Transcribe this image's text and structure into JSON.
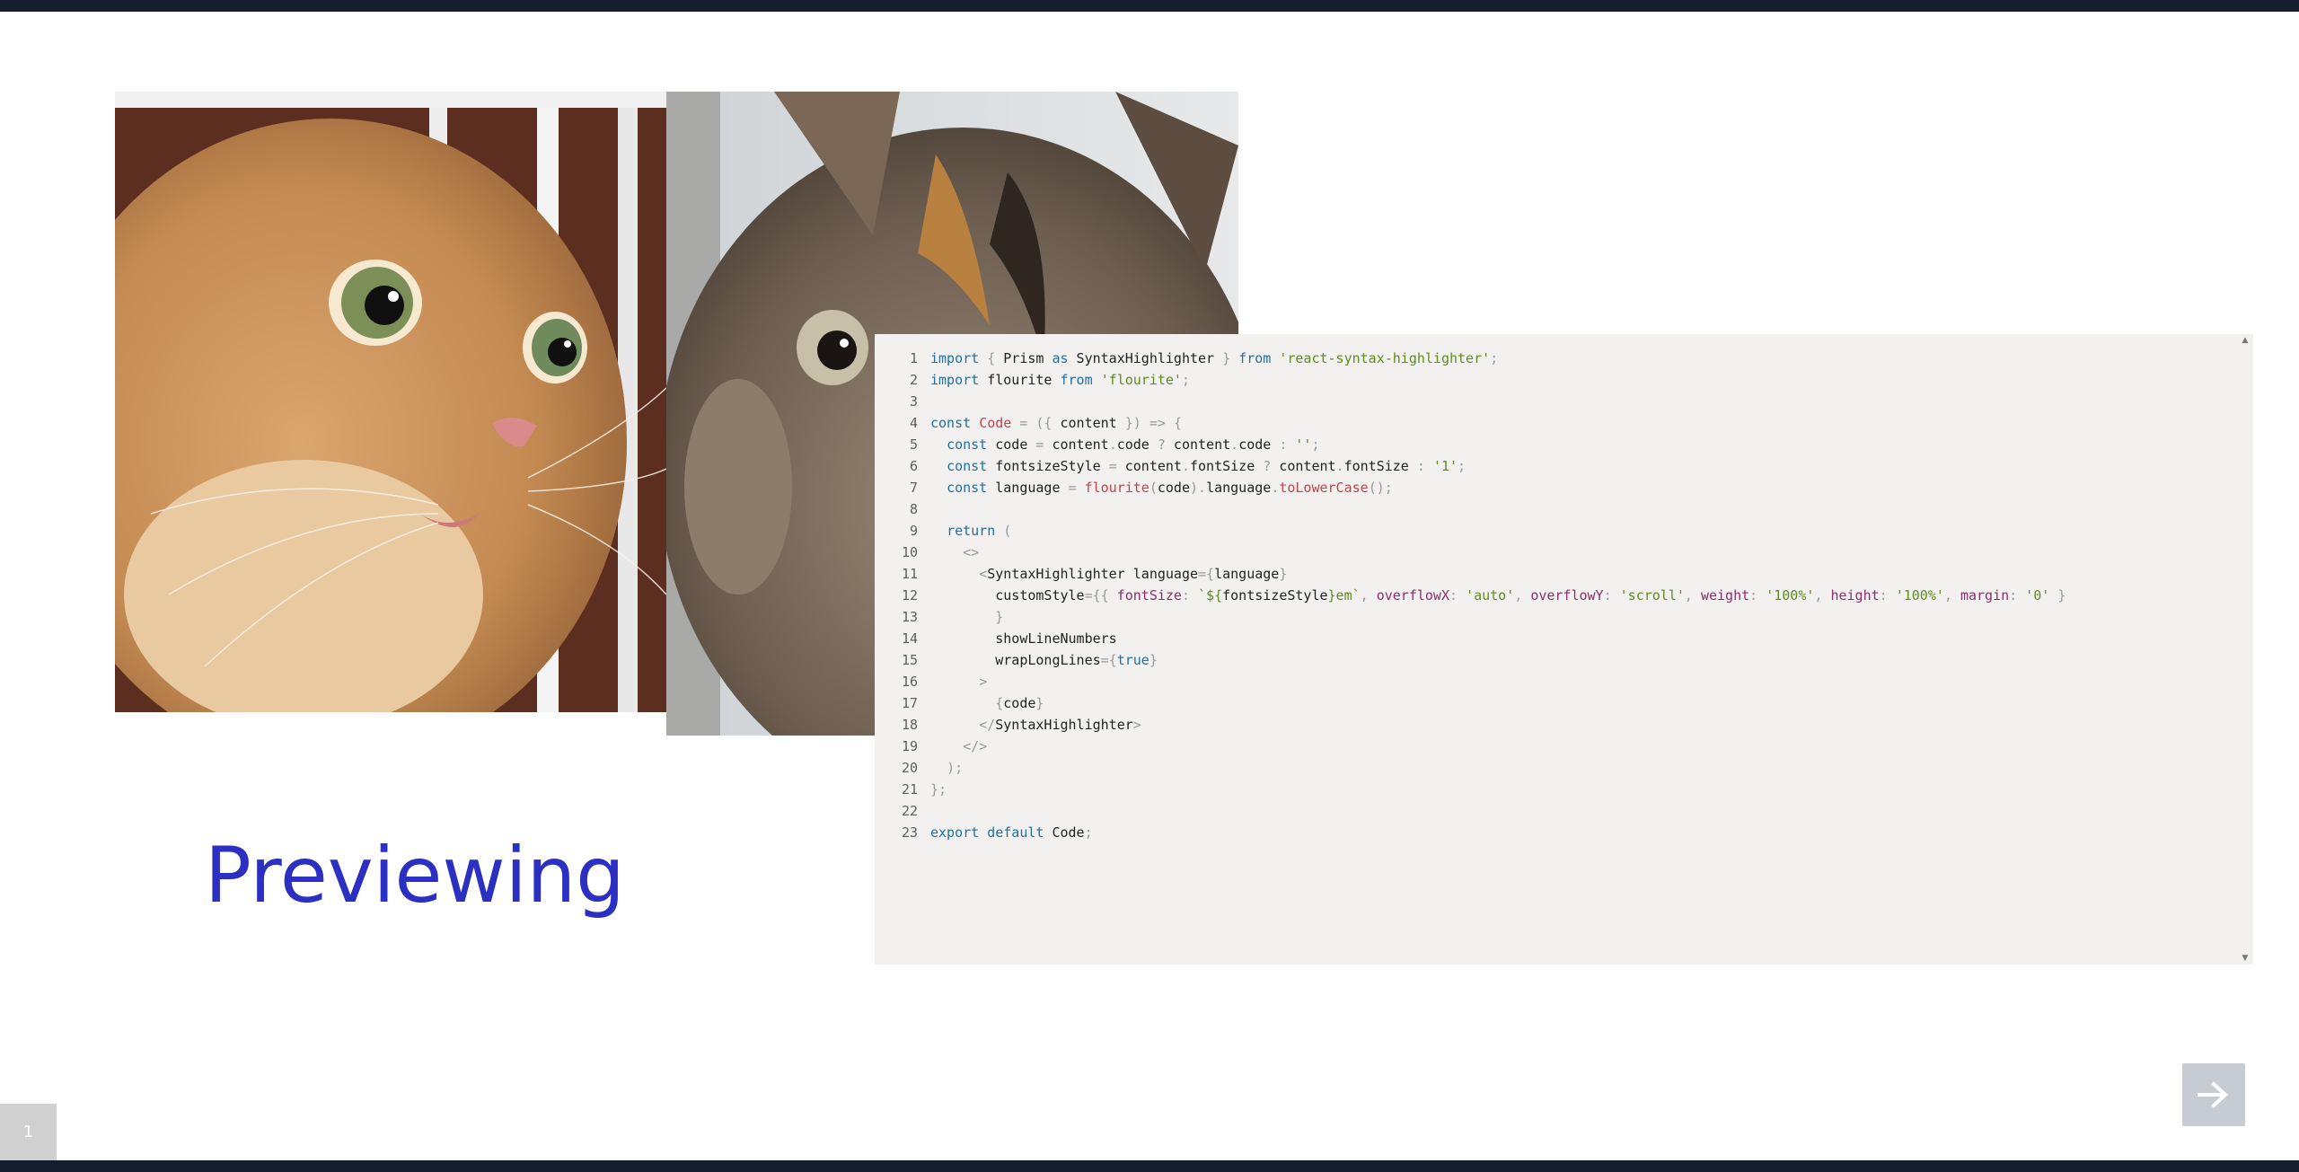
{
  "slide": {
    "title": "Previewing",
    "page_number": "1"
  },
  "images": {
    "left": "cat-photo",
    "right": "cat-photo"
  },
  "code_block": {
    "language": "javascript",
    "lines": [
      [
        [
          "kw",
          "import"
        ],
        [
          "plain",
          " "
        ],
        [
          "punct",
          "{"
        ],
        [
          "plain",
          " Prism "
        ],
        [
          "kw",
          "as"
        ],
        [
          "plain",
          " SyntaxHighlighter "
        ],
        [
          "punct",
          "}"
        ],
        [
          "plain",
          " "
        ],
        [
          "kw",
          "from"
        ],
        [
          "plain",
          " "
        ],
        [
          "str",
          "'react-syntax-highlighter'"
        ],
        [
          "punct",
          ";"
        ]
      ],
      [
        [
          "kw",
          "import"
        ],
        [
          "plain",
          " flourite "
        ],
        [
          "kw",
          "from"
        ],
        [
          "plain",
          " "
        ],
        [
          "str",
          "'flourite'"
        ],
        [
          "punct",
          ";"
        ]
      ],
      [],
      [
        [
          "kw",
          "const"
        ],
        [
          "plain",
          " "
        ],
        [
          "fn",
          "Code"
        ],
        [
          "plain",
          " "
        ],
        [
          "punct",
          "="
        ],
        [
          "plain",
          " "
        ],
        [
          "punct",
          "({"
        ],
        [
          "plain",
          " content "
        ],
        [
          "punct",
          "})"
        ],
        [
          "plain",
          " "
        ],
        [
          "punct",
          "=>"
        ],
        [
          "plain",
          " "
        ],
        [
          "punct",
          "{"
        ]
      ],
      [
        [
          "plain",
          "  "
        ],
        [
          "kw",
          "const"
        ],
        [
          "plain",
          " code "
        ],
        [
          "punct",
          "="
        ],
        [
          "plain",
          " content"
        ],
        [
          "punct",
          "."
        ],
        [
          "plain",
          "code "
        ],
        [
          "punct",
          "?"
        ],
        [
          "plain",
          " content"
        ],
        [
          "punct",
          "."
        ],
        [
          "plain",
          "code "
        ],
        [
          "punct",
          ":"
        ],
        [
          "plain",
          " "
        ],
        [
          "str",
          "''"
        ],
        [
          "punct",
          ";"
        ]
      ],
      [
        [
          "plain",
          "  "
        ],
        [
          "kw",
          "const"
        ],
        [
          "plain",
          " fontsizeStyle "
        ],
        [
          "punct",
          "="
        ],
        [
          "plain",
          " content"
        ],
        [
          "punct",
          "."
        ],
        [
          "plain",
          "fontSize "
        ],
        [
          "punct",
          "?"
        ],
        [
          "plain",
          " content"
        ],
        [
          "punct",
          "."
        ],
        [
          "plain",
          "fontSize "
        ],
        [
          "punct",
          ":"
        ],
        [
          "plain",
          " "
        ],
        [
          "str",
          "'1'"
        ],
        [
          "punct",
          ";"
        ]
      ],
      [
        [
          "plain",
          "  "
        ],
        [
          "kw",
          "const"
        ],
        [
          "plain",
          " language "
        ],
        [
          "punct",
          "="
        ],
        [
          "plain",
          " "
        ],
        [
          "fn",
          "flourite"
        ],
        [
          "punct",
          "("
        ],
        [
          "plain",
          "code"
        ],
        [
          "punct",
          ")."
        ],
        [
          "plain",
          "language"
        ],
        [
          "punct",
          "."
        ],
        [
          "fn",
          "toLowerCase"
        ],
        [
          "punct",
          "();"
        ]
      ],
      [],
      [
        [
          "plain",
          "  "
        ],
        [
          "kw",
          "return"
        ],
        [
          "plain",
          " "
        ],
        [
          "punct",
          "("
        ]
      ],
      [
        [
          "plain",
          "    "
        ],
        [
          "punct",
          "<>"
        ]
      ],
      [
        [
          "plain",
          "      "
        ],
        [
          "punct",
          "<"
        ],
        [
          "plain",
          "SyntaxHighlighter language"
        ],
        [
          "punct",
          "={"
        ],
        [
          "plain",
          "language"
        ],
        [
          "punct",
          "}"
        ]
      ],
      [
        [
          "plain",
          "        customStyle"
        ],
        [
          "punct",
          "={{"
        ],
        [
          "plain",
          " "
        ],
        [
          "attr",
          "fontSize"
        ],
        [
          "punct",
          ":"
        ],
        [
          "plain",
          " "
        ],
        [
          "str",
          "`${"
        ],
        [
          "plain",
          "fontsizeStyle"
        ],
        [
          "str",
          "}em`"
        ],
        [
          "punct",
          ","
        ],
        [
          "plain",
          " "
        ],
        [
          "attr",
          "overflowX"
        ],
        [
          "punct",
          ":"
        ],
        [
          "plain",
          " "
        ],
        [
          "str",
          "'auto'"
        ],
        [
          "punct",
          ","
        ],
        [
          "plain",
          " "
        ],
        [
          "attr",
          "overflowY"
        ],
        [
          "punct",
          ":"
        ],
        [
          "plain",
          " "
        ],
        [
          "str",
          "'scroll'"
        ],
        [
          "punct",
          ","
        ],
        [
          "plain",
          " "
        ],
        [
          "attr",
          "weight"
        ],
        [
          "punct",
          ":"
        ],
        [
          "plain",
          " "
        ],
        [
          "str",
          "'100%'"
        ],
        [
          "punct",
          ","
        ],
        [
          "plain",
          " "
        ],
        [
          "attr",
          "height"
        ],
        [
          "punct",
          ":"
        ],
        [
          "plain",
          " "
        ],
        [
          "str",
          "'100%'"
        ],
        [
          "punct",
          ","
        ],
        [
          "plain",
          " "
        ],
        [
          "attr",
          "margin"
        ],
        [
          "punct",
          ":"
        ],
        [
          "plain",
          " "
        ],
        [
          "str",
          "'0'"
        ],
        [
          "plain",
          " "
        ],
        [
          "punct",
          "}"
        ]
      ],
      [
        [
          "plain",
          "        "
        ],
        [
          "punct",
          "}"
        ]
      ],
      [
        [
          "plain",
          "        showLineNumbers"
        ]
      ],
      [
        [
          "plain",
          "        wrapLongLines"
        ],
        [
          "punct",
          "={"
        ],
        [
          "kw",
          "true"
        ],
        [
          "punct",
          "}"
        ]
      ],
      [
        [
          "plain",
          "      "
        ],
        [
          "punct",
          ">"
        ]
      ],
      [
        [
          "plain",
          "        "
        ],
        [
          "punct",
          "{"
        ],
        [
          "plain",
          "code"
        ],
        [
          "punct",
          "}"
        ]
      ],
      [
        [
          "plain",
          "      "
        ],
        [
          "punct",
          "</"
        ],
        [
          "plain",
          "SyntaxHighlighter"
        ],
        [
          "punct",
          ">"
        ]
      ],
      [
        [
          "plain",
          "    "
        ],
        [
          "punct",
          "</>"
        ]
      ],
      [
        [
          "plain",
          "  "
        ],
        [
          "punct",
          ");"
        ]
      ],
      [
        [
          "punct",
          "};"
        ]
      ],
      [],
      [
        [
          "kw",
          "export"
        ],
        [
          "plain",
          " "
        ],
        [
          "kw",
          "default"
        ],
        [
          "plain",
          " Code"
        ],
        [
          "punct",
          ";"
        ]
      ]
    ]
  },
  "navigation": {
    "next_icon": "arrow-right-icon"
  },
  "colors": {
    "top_bar": "#141d2b",
    "title": "#2b2fc2",
    "code_background": "#f2f1ef",
    "keyword": "#1f6fa3",
    "string": "#5f8b22",
    "function": "#c2434c",
    "attribute": "#8a2d6a"
  }
}
